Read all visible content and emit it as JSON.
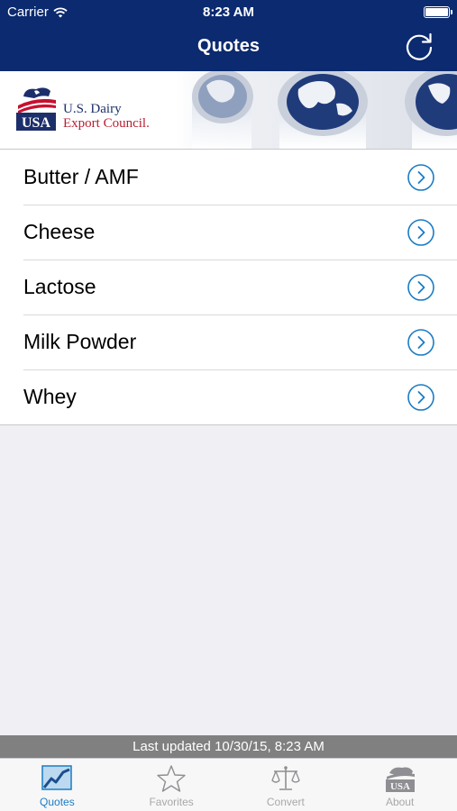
{
  "status_bar": {
    "carrier": "Carrier",
    "time": "8:23 AM",
    "battery_level": 1.0
  },
  "nav": {
    "title": "Quotes",
    "refresh_icon": "refresh-icon"
  },
  "banner": {
    "logo_badge": "USA",
    "org_line1": "U.S. Dairy",
    "org_line2": "Export Council."
  },
  "quotes": [
    {
      "label": "Butter / AMF"
    },
    {
      "label": "Cheese"
    },
    {
      "label": "Lactose"
    },
    {
      "label": "Milk Powder"
    },
    {
      "label": "Whey"
    }
  ],
  "footer": {
    "last_updated": "Last updated 10/30/15, 8:23 AM"
  },
  "tabs": [
    {
      "label": "Quotes",
      "icon": "chart-icon",
      "active": true
    },
    {
      "label": "Favorites",
      "icon": "star-icon",
      "active": false
    },
    {
      "label": "Convert",
      "icon": "scale-icon",
      "active": false
    },
    {
      "label": "About",
      "icon": "usa-cow-icon",
      "active": false
    }
  ],
  "colors": {
    "nav_bg": "#0b2a6f",
    "accent": "#1a7cc4",
    "background": "#efeff4",
    "update_bar": "#808080"
  }
}
